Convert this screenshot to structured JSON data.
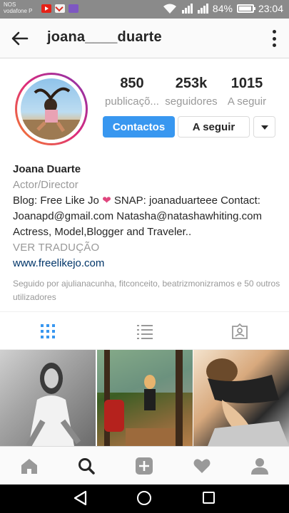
{
  "status_bar": {
    "carrier_line1": "NOS",
    "carrier_line2": "vodafone P",
    "battery_percent": "84%",
    "time": "23:04",
    "notification_icons": [
      "youtube-icon",
      "gmail-icon",
      "photos-icon"
    ]
  },
  "header": {
    "username": "joana____duarte"
  },
  "profile": {
    "stats": {
      "posts_count": "850",
      "posts_label": "publicaçõ...",
      "followers_count": "253k",
      "followers_label": "seguidores",
      "following_count": "1015",
      "following_label": "A seguir"
    },
    "buttons": {
      "contacts_label": "Contactos",
      "follow_label": "A seguir"
    },
    "bio": {
      "name": "Joana Duarte",
      "category": "Actor/Director",
      "text_before_heart": "Blog: Free Like Jo",
      "heart": "❤",
      "text_after_heart": "SNAP: joanaduarteee Contact: Joanapd@gmail.com Natasha@natashawhiting.com Actress, Model,Blogger and Traveler..",
      "translate_label": "VER TRADUÇÃO",
      "website": "www.freelikejo.com",
      "followed_by": "Seguido por ajulianacunha, fitconceito, beatrizmonizramos e 50 outros utilizadores"
    }
  },
  "tabs": [
    "grid-tab",
    "list-tab",
    "tagged-tab"
  ],
  "colors": {
    "accent": "#3897f0",
    "active_tab": "#3897f0",
    "heart": "#e0467e",
    "link": "#003569"
  }
}
